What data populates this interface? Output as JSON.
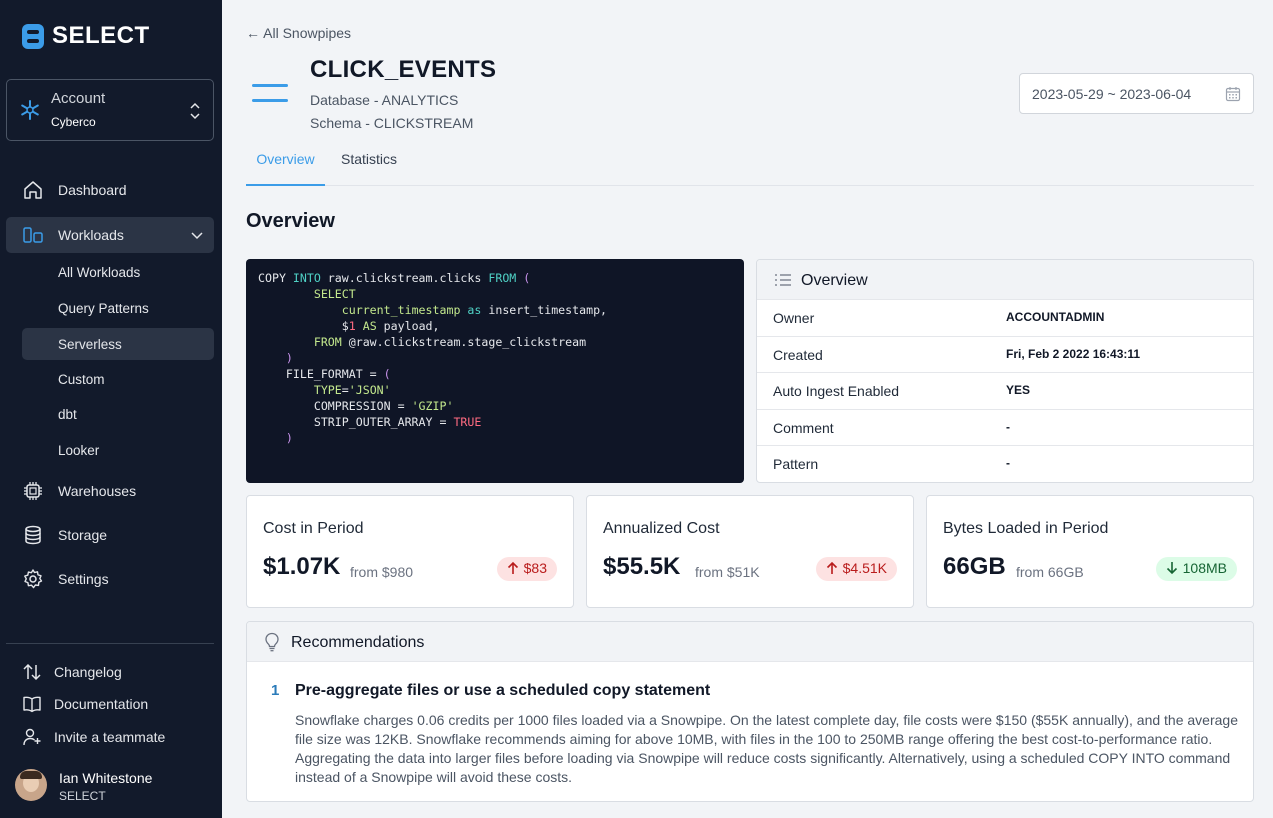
{
  "brand": {
    "name": "SELECT",
    "color": "#3b9ce8"
  },
  "account": {
    "label": "Account",
    "value": "Cyberco"
  },
  "nav": {
    "dashboard": "Dashboard",
    "workloads": "Workloads",
    "workloads_children": [
      "All Workloads",
      "Query Patterns",
      "Serverless",
      "Custom",
      "dbt",
      "Looker"
    ],
    "warehouses": "Warehouses",
    "storage": "Storage",
    "settings": "Settings"
  },
  "footer": {
    "changelog": "Changelog",
    "documentation": "Documentation",
    "invite": "Invite a teammate"
  },
  "user": {
    "name": "Ian Whitestone",
    "org": "SELECT"
  },
  "header": {
    "back": "← All Snowpipes",
    "title": "CLICK_EVENTS",
    "database": "Database - ANALYTICS",
    "schema": "Schema - CLICKSTREAM",
    "date_range": "2023-05-29 ~ 2023-06-04"
  },
  "tabs": [
    "Overview",
    "Statistics"
  ],
  "section_title": "Overview",
  "overview": {
    "title": "Overview",
    "rows": [
      {
        "key": "Owner",
        "value": "ACCOUNTADMIN"
      },
      {
        "key": "Created",
        "value": "Fri, Feb 2 2022 16:43:11"
      },
      {
        "key": "Auto Ingest Enabled",
        "value": "YES"
      },
      {
        "key": "Comment",
        "value": "-"
      },
      {
        "key": "Pattern",
        "value": "-"
      }
    ]
  },
  "stats": [
    {
      "title": "Cost in Period",
      "value": "$1.07K",
      "from": "from $980",
      "delta": "$83",
      "direction": "up"
    },
    {
      "title": "Annualized Cost",
      "value": "$55.5K",
      "from": "from $51K",
      "delta": "$4.51K",
      "direction": "up"
    },
    {
      "title": "Bytes Loaded in Period",
      "value": "66GB",
      "from": "from 66GB",
      "delta": "108MB",
      "direction": "down"
    }
  ],
  "recommendations": {
    "title": "Recommendations",
    "items": [
      {
        "number": "1",
        "title": "Pre-aggregate files or use a scheduled copy statement",
        "body": "Snowflake charges 0.06 credits per 1000 files loaded via a Snowpipe. On the latest complete day, file costs were $150 ($55K annually), and the average file size was 12KB. Snowflake recommends aiming for above 10MB, with files in the 100 to 250MB range offering the best cost-to-performance ratio. Aggregating the data into larger files before loading via Snowpipe will reduce costs significantly. Alternatively, using a scheduled COPY INTO command instead of a Snowpipe will avoid these costs."
      }
    ]
  }
}
